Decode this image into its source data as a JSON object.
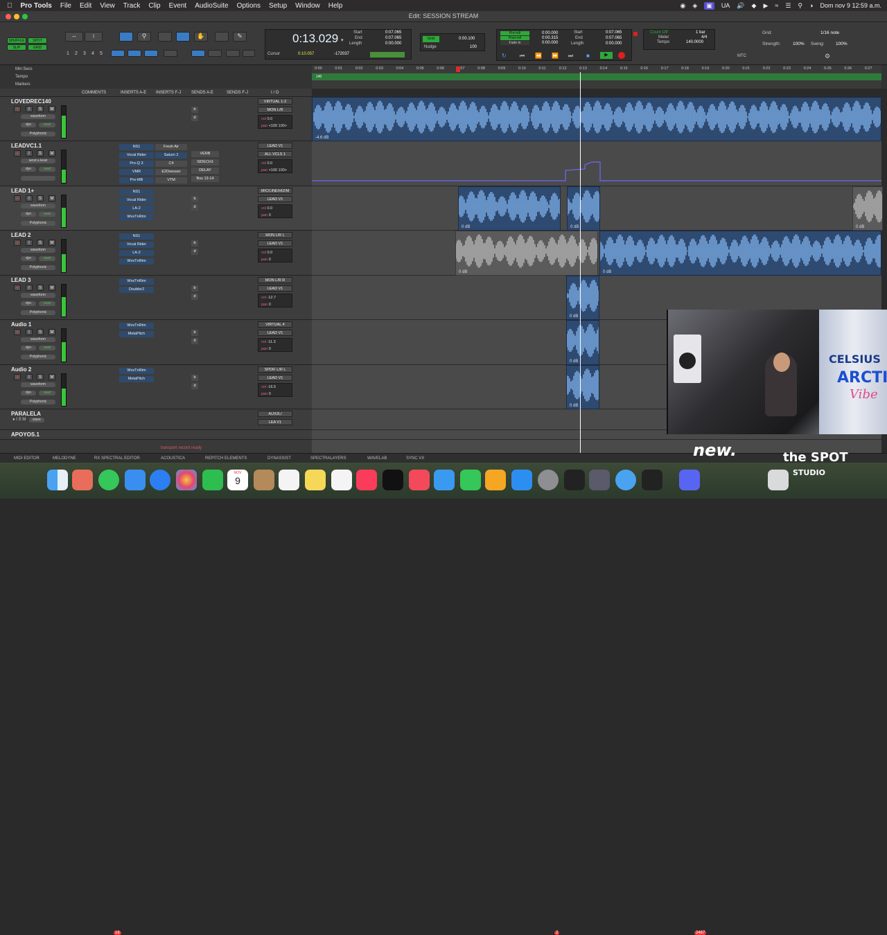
{
  "menubar": {
    "app": "Pro Tools",
    "items": [
      "File",
      "Edit",
      "View",
      "Track",
      "Clip",
      "Event",
      "AudioSuite",
      "Options",
      "Setup",
      "Window",
      "Help"
    ],
    "status_ua": "UA",
    "datetime": "Dom nov 9  12:59 a.m."
  },
  "window": {
    "title": "Edit: SESSION STREAM"
  },
  "toolbar": {
    "mode_shuffle": "SHUFFLE",
    "mode_spot": "SPOT",
    "mode_slip": "SLIP",
    "mode_grid": "GRID",
    "zoom_presets": [
      "1",
      "2",
      "3",
      "4",
      "5"
    ],
    "main_counter": "0:13.029",
    "start_label": "Start",
    "end_label": "End",
    "length_label": "Length",
    "start": "0:07.065",
    "end": "0:07.065",
    "length": "0:00.000",
    "cursor_label": "Cursor",
    "cursor_value": "0:10.057",
    "cursor_sample": "-172037",
    "grid_label": "Grid",
    "grid_value": "0:00.100",
    "nudge_label": "Nudge",
    "nudge_value": "100",
    "preroll_label": "Pre-roll",
    "postroll_label": "Post-roll",
    "fadein_label": "Fade-in",
    "preroll": "0:00.000",
    "postroll": "0:00.315",
    "fadein": "0:00.000",
    "start2": "0:07.065",
    "end2": "0:07.065",
    "length2": "0:00.000",
    "countoff_label": "Count Off",
    "meter_label": "Meter",
    "tempo_label": "Tempo",
    "countoff": "1 bar",
    "meter": "4/4",
    "tempo": "140.0000",
    "mtc_label": "MTC",
    "grid2_label": "Grid:",
    "grid2_value": "1/16 note",
    "strength_label": "Strength:",
    "strength": "100%",
    "swing_label": "Swing:",
    "swing": "100%"
  },
  "rulers": {
    "min_secs": "Min:Secs",
    "tempo": "Tempo",
    "markers": "Markers",
    "ticks": [
      "0:00",
      "0:01",
      "0:02",
      "0:03",
      "0:04",
      "0:05",
      "0:06",
      "0:07",
      "0:08",
      "0:09",
      "0:10",
      "0:11",
      "0:12",
      "0:13",
      "0:14",
      "0:15",
      "0:16",
      "0:17",
      "0:18",
      "0:19",
      "0:20",
      "0:21",
      "0:22",
      "0:23",
      "0:24",
      "0:25",
      "0:26",
      "0:27"
    ],
    "tempo_value": "140"
  },
  "columns": {
    "comments": "COMMENTS",
    "inserts_ae": "INSERTS A-E",
    "inserts_fj": "INSERTS F-J",
    "sends_ae": "SENDS A-E",
    "sends_fj": "SENDS F-J",
    "io": "I / O"
  },
  "tracks": [
    {
      "name": "LOVEDREC140",
      "view": "waveform",
      "dyn": "dyn",
      "read": "read",
      "elastic": "Polyphonic",
      "inserts": [],
      "inserts2": [],
      "io_in": "VIRTUAL 1-2",
      "io_out": "MON L/R",
      "vol": "0.0",
      "pan": "<100  100>",
      "sends": [
        "b",
        "d"
      ]
    },
    {
      "name": "LEADVC1.1",
      "view": "send a level",
      "dyn": "dyn",
      "read": "read",
      "elastic": "",
      "inserts": [
        "NS1",
        "Vocal Rider",
        "Pro-Q 3",
        "VMR",
        "Pro-MB"
      ],
      "inserts2": [
        "Fresh Air",
        "Saturn 2",
        "C4",
        "E2Deesser",
        "VTM"
      ],
      "sends": [
        "VERB",
        "SIDECH1",
        "DELAY",
        "Bus 13-14"
      ],
      "io_in": "LEAD V1",
      "io_out": "ALL VCLS 1",
      "vol": "0.0",
      "pan": "<100  100>"
    },
    {
      "name": "LEAD 1+",
      "view": "waveform",
      "dyn": "dyn",
      "read": "read",
      "elastic": "Polyphonic",
      "inserts": [
        "NS1",
        "Vocal Rider",
        "LA-2",
        "WvsTnRtm"
      ],
      "inserts2": [],
      "sends": [
        "b",
        "d"
      ],
      "io_in": "MIC/LINE/HIZ/M",
      "io_out": "LEAD V1",
      "vol": "0.0",
      "pan": "0"
    },
    {
      "name": "LEAD 2",
      "view": "waveform",
      "dyn": "dyn",
      "read": "read",
      "elastic": "Polyphonic",
      "inserts": [
        "NS1",
        "Vocal Rider",
        "LA-2",
        "WvsTnRtm"
      ],
      "inserts2": [],
      "sends": [
        "b",
        "d"
      ],
      "io_in": "MON L/R L",
      "io_out": "LEAD V1",
      "vol": "0.0",
      "pan": "0"
    },
    {
      "name": "LEAD 3",
      "view": "waveform",
      "dyn": "dyn",
      "read": "read",
      "elastic": "Polyphonic",
      "inserts": [
        "WvsTnRtm",
        "Doubler2"
      ],
      "inserts2": [],
      "sends": [
        "b",
        "d"
      ],
      "io_in": "MON L/R R",
      "io_out": "LEAD V1",
      "vol": "-12.7",
      "pan": "0"
    },
    {
      "name": "Audio 1",
      "view": "waveform",
      "dyn": "dyn",
      "read": "read",
      "elastic": "Polyphonic",
      "inserts": [
        "WvsTnRtm",
        "MetaPitch"
      ],
      "inserts2": [],
      "sends": [
        "b",
        "d"
      ],
      "io_in": "VIRTUAL 4",
      "io_out": "LEAD V1",
      "vol": "-11.3",
      "pan": "0"
    },
    {
      "name": "Audio 2",
      "view": "waveform",
      "dyn": "dyn",
      "read": "read",
      "elastic": "Polyphonic",
      "inserts": [
        "WvsTnRtm",
        "MetaPitch"
      ],
      "inserts2": [],
      "sends": [
        "b",
        "d"
      ],
      "io_in": "SPDIF L/R L",
      "io_out": "LEAD V1",
      "vol": "-16.5",
      "pan": "0"
    },
    {
      "name": "PARALELA",
      "view": "wave",
      "dyn": "",
      "read": "",
      "elastic": "",
      "inserts": [],
      "inserts2": [],
      "sends": [],
      "io_in": "AUX2L/",
      "io_out": "LEA V1",
      "vol": "0.0",
      "pan": "0"
    },
    {
      "name": "APOYOS.1",
      "view": "",
      "dyn": "",
      "read": "",
      "elastic": "",
      "inserts": [],
      "inserts2": [],
      "sends": [],
      "io_in": "APOYOS",
      "io_out": "ALV",
      "vol": "",
      "pan": ""
    }
  ],
  "clip_gain": {
    "lovedrec": "-4.6 dB",
    "lead1_a": "0 dB",
    "lead1_b": "0 dB",
    "lead1_c": "0 dB",
    "lead2_a": "0 dB",
    "lead2_b": "0 dB",
    "lead3": "0 dB",
    "audio1": "0 dB",
    "audio2": "0 dB"
  },
  "status": {
    "transport": "transport record ready"
  },
  "bottom_tabs": [
    "MIDI EDITOR",
    "MELODYNE",
    "RX SPECTRAL EDITOR",
    "ACOUSTICA",
    "REPITCH ELEMENTS",
    "DYNASSIST",
    "SPECTRALAYERS",
    "WAVELAB",
    "SYNC VX"
  ],
  "dock": {
    "calendar_month": "NOV",
    "calendar_day": "9",
    "badge_messages": "16",
    "badge_2": "2",
    "badge_3": "2487"
  },
  "overlay": {
    "logo_new": "new.",
    "logo_spot": "the SPOT",
    "logo_studio": "STUDIO",
    "can_brand": "CELSIUS",
    "can_line": "ARCTIC",
    "can_vibe": "Vibe"
  },
  "colors": {
    "accent_blue": "#3a7cc4",
    "clip_blue": "#2e4a70",
    "meter_green": "#3bc43b",
    "record_red": "#c92a2a",
    "timeline_green": "#2f7a3b"
  }
}
